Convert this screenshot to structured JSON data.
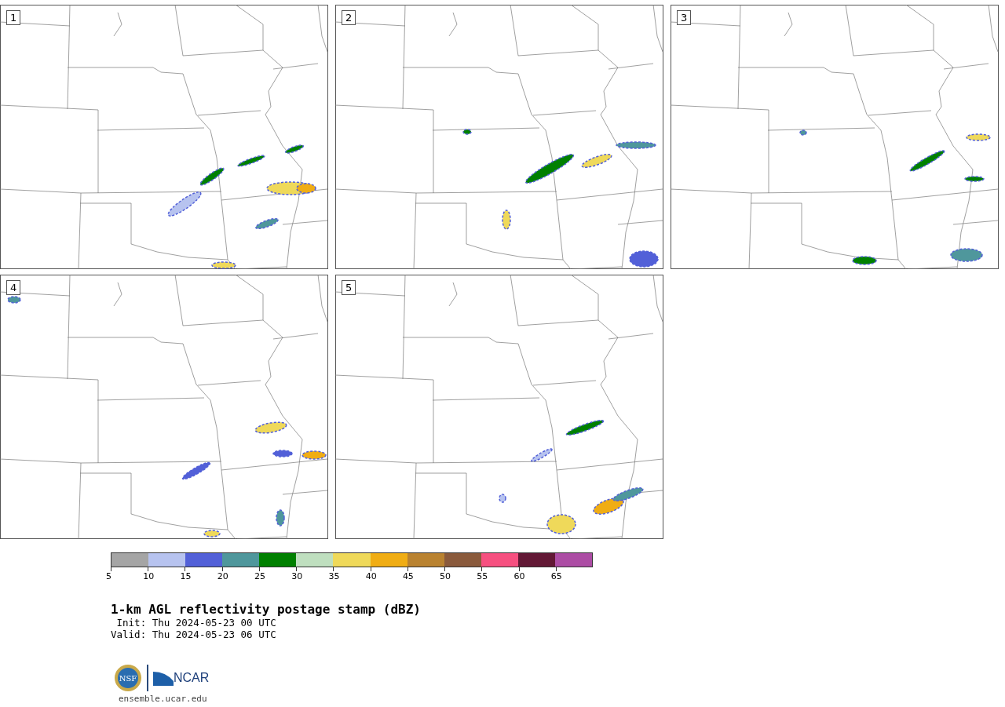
{
  "panels": [
    {
      "label": "1"
    },
    {
      "label": "2"
    },
    {
      "label": "3"
    },
    {
      "label": "4"
    },
    {
      "label": "5"
    }
  ],
  "colorbar": {
    "segments": [
      {
        "label": "5",
        "color": "#a5a5a5"
      },
      {
        "label": "10",
        "color": "#b7c3ef"
      },
      {
        "label": "15",
        "color": "#5260d8"
      },
      {
        "label": "20",
        "color": "#4f979c"
      },
      {
        "label": "25",
        "color": "#008000"
      },
      {
        "label": "30",
        "color": "#bfdfbf"
      },
      {
        "label": "35",
        "color": "#efd95a"
      },
      {
        "label": "40",
        "color": "#f0ad14"
      },
      {
        "label": "45",
        "color": "#b98230"
      },
      {
        "label": "50",
        "color": "#8a5a3c"
      },
      {
        "label": "55",
        "color": "#f65080"
      },
      {
        "label": "60",
        "color": "#621835"
      },
      {
        "label": "65",
        "color": "#ac4ca4"
      }
    ]
  },
  "title": "1-km AGL reflectivity postage stamp (dBZ)",
  "init": " Init: Thu 2024-05-23 00 UTC",
  "valid": "Valid: Thu 2024-05-23 06 UTC",
  "logo": {
    "nsf": "NSF",
    "ncar": "NCAR"
  },
  "url": "ensemble.ucar.edu"
}
